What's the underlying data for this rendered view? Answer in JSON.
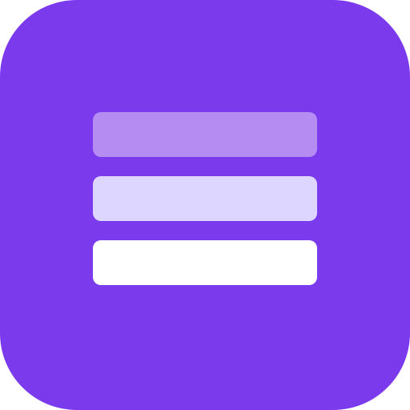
{
  "icon": {
    "semantic": "stacked-layers-icon",
    "background_color": "#7C3AED",
    "layers": [
      {
        "name": "top",
        "color": "#B48CF2"
      },
      {
        "name": "middle",
        "color": "#DDD6FE"
      },
      {
        "name": "bottom",
        "color": "#FFFFFF"
      }
    ]
  }
}
